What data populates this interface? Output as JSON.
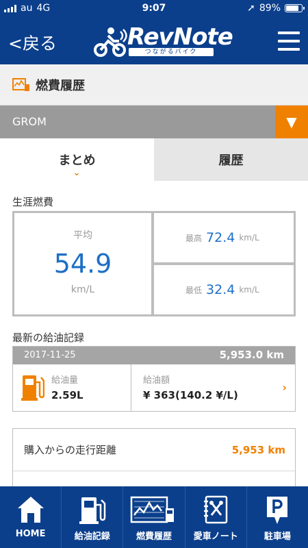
{
  "status": {
    "carrier": "au",
    "network": "4G",
    "time": "9:07",
    "battery": "89%"
  },
  "nav": {
    "back_label": "<戻る",
    "logo_name": "RevNote",
    "logo_sub": "つながるバイク"
  },
  "page": {
    "title": "燃費履歴"
  },
  "selector": {
    "value": "GROM",
    "button": "▼"
  },
  "tabs": [
    {
      "label": "まとめ"
    },
    {
      "label": "履歴"
    }
  ],
  "lifetime": {
    "section": "生涯燃費",
    "avg_label": "平均",
    "avg_value": "54.9",
    "avg_unit": "km/L",
    "max_label": "最高",
    "max_value": "72.4",
    "max_unit": "km/L",
    "min_label": "最低",
    "min_value": "32.4",
    "min_unit": "km/L"
  },
  "recent": {
    "section": "最新の給油記録",
    "date": "2017-11-25",
    "odometer": "5,953.0 km",
    "amount_label": "給油量",
    "amount_value": "2.59L",
    "cost_label": "給油額",
    "cost_value": "¥ 363(140.2 ¥/L)"
  },
  "distance": {
    "label": "購入からの走行距離",
    "value": "5,953 km"
  },
  "tabbar": [
    {
      "label": "HOME",
      "icon": "home-icon"
    },
    {
      "label": "給油記録",
      "icon": "fuel-pump-icon"
    },
    {
      "label": "燃費履歴",
      "icon": "fuel-chart-icon"
    },
    {
      "label": "愛車ノート",
      "icon": "notebook-tools-icon"
    },
    {
      "label": "駐車場",
      "icon": "parking-icon"
    }
  ],
  "colors": {
    "navy": "#0b3f8c",
    "orange": "#f08100",
    "value_blue": "#1d6fc6"
  }
}
